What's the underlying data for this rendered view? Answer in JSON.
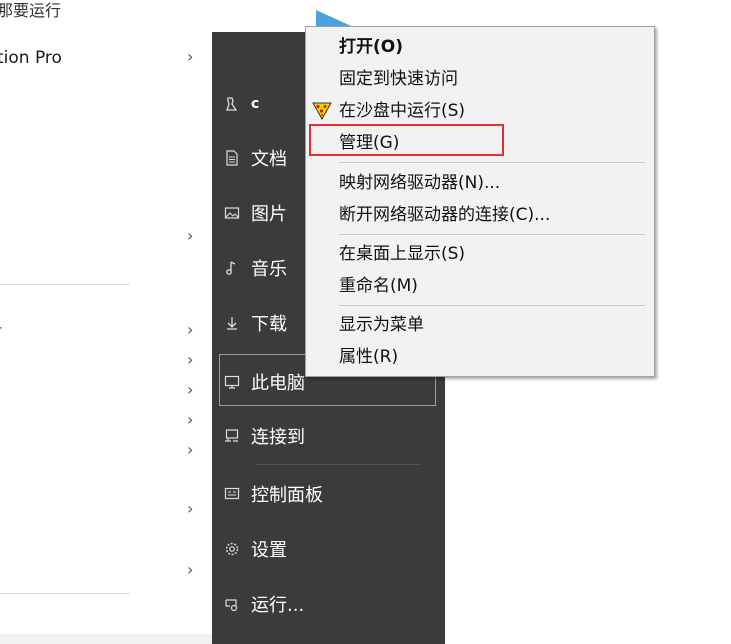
{
  "top": {
    "partial_title": "那要运行"
  },
  "left_panel": {
    "partial_item": "tion Pro",
    "partial_mark": "-"
  },
  "sidebar": {
    "items": [
      {
        "label": "c",
        "icon": "user-icon"
      },
      {
        "label": "文档",
        "icon": "document-icon"
      },
      {
        "label": "图片",
        "icon": "picture-icon"
      },
      {
        "label": "音乐",
        "icon": "music-icon"
      },
      {
        "label": "下载",
        "icon": "download-icon"
      },
      {
        "label": "此电脑",
        "icon": "computer-icon"
      },
      {
        "label": "连接到",
        "icon": "connect-icon"
      },
      {
        "label": "控制面板",
        "icon": "control-panel-icon"
      },
      {
        "label": "设置",
        "icon": "gear-icon"
      },
      {
        "label": "运行...",
        "icon": "run-icon"
      }
    ]
  },
  "context_menu": {
    "items": [
      {
        "label": "打开(O)",
        "bold": true
      },
      {
        "label": "固定到快速访问"
      },
      {
        "label": "在沙盘中运行(S)",
        "icon": "sandbox-icon"
      },
      {
        "label": "管理(G)",
        "highlighted": true
      },
      {
        "label": "映射网络驱动器(N)..."
      },
      {
        "label": "断开网络驱动器的连接(C)..."
      },
      {
        "label": "在桌面上显示(S)"
      },
      {
        "label": "重命名(M)"
      },
      {
        "label": "显示为菜单"
      },
      {
        "label": "属性(R)"
      }
    ]
  },
  "colors": {
    "sidebar_bg": "#3b3b3b",
    "menu_bg": "#f2f2f2",
    "highlight_border": "#e0302f"
  }
}
